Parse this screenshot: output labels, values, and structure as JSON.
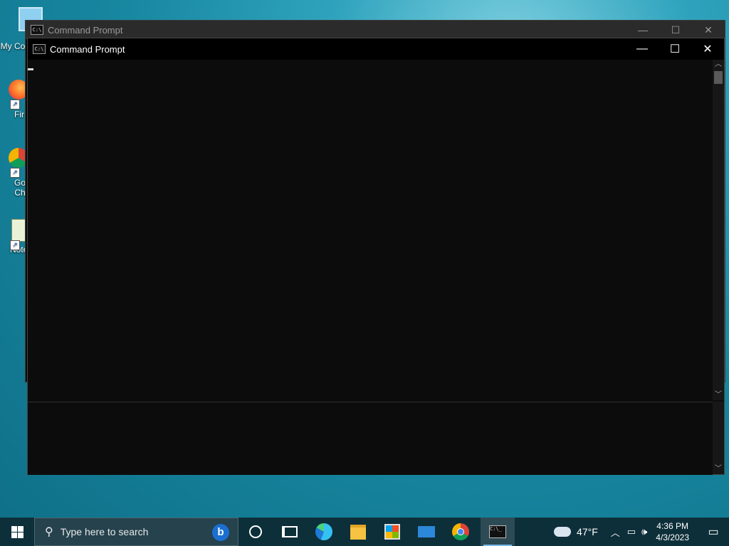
{
  "desktop": {
    "icons": [
      {
        "label": "My Co"
      },
      {
        "label": "Fir"
      },
      {
        "label": "Go Ch"
      },
      {
        "label": "Note"
      }
    ]
  },
  "back_window": {
    "title": "Command Prompt"
  },
  "front_window": {
    "title": "Command Prompt",
    "minimize": "—",
    "maximize": "☐",
    "close": "✕"
  },
  "taskbar": {
    "search_placeholder": "Type here to search",
    "weather_temp": "47°F",
    "time": "4:36 PM",
    "date": "4/3/2023"
  },
  "colors": {
    "console_bg": "#0c0c0c",
    "taskbar_bg": "#0d2f3a",
    "accent": "#7ab8e8"
  }
}
